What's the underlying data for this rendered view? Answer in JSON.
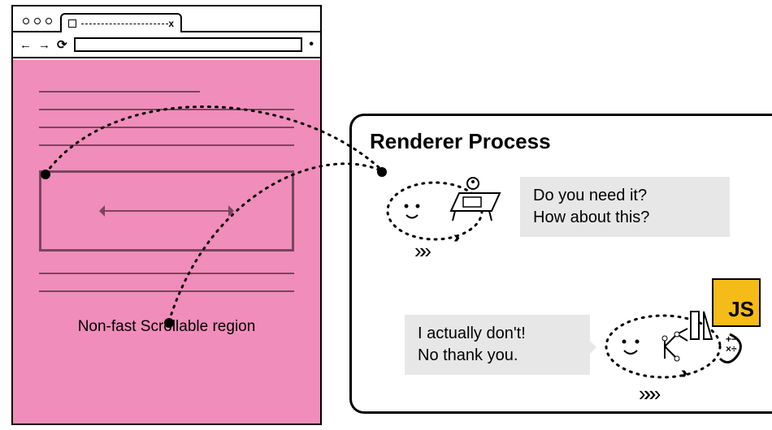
{
  "browser": {
    "caption": "Non-fast Scrollable region",
    "tab": {
      "close_glyph": "x"
    },
    "nav": {
      "back_glyph": "←",
      "forward_glyph": "→",
      "reload_glyph": "⟳"
    }
  },
  "renderer": {
    "title": "Renderer Process",
    "compositor_speech_line1": "Do you need it?",
    "compositor_speech_line2": "How about this?",
    "main_speech_line1": "I actually don't!",
    "main_speech_line2": "No thank you.",
    "js_label": "JS"
  }
}
